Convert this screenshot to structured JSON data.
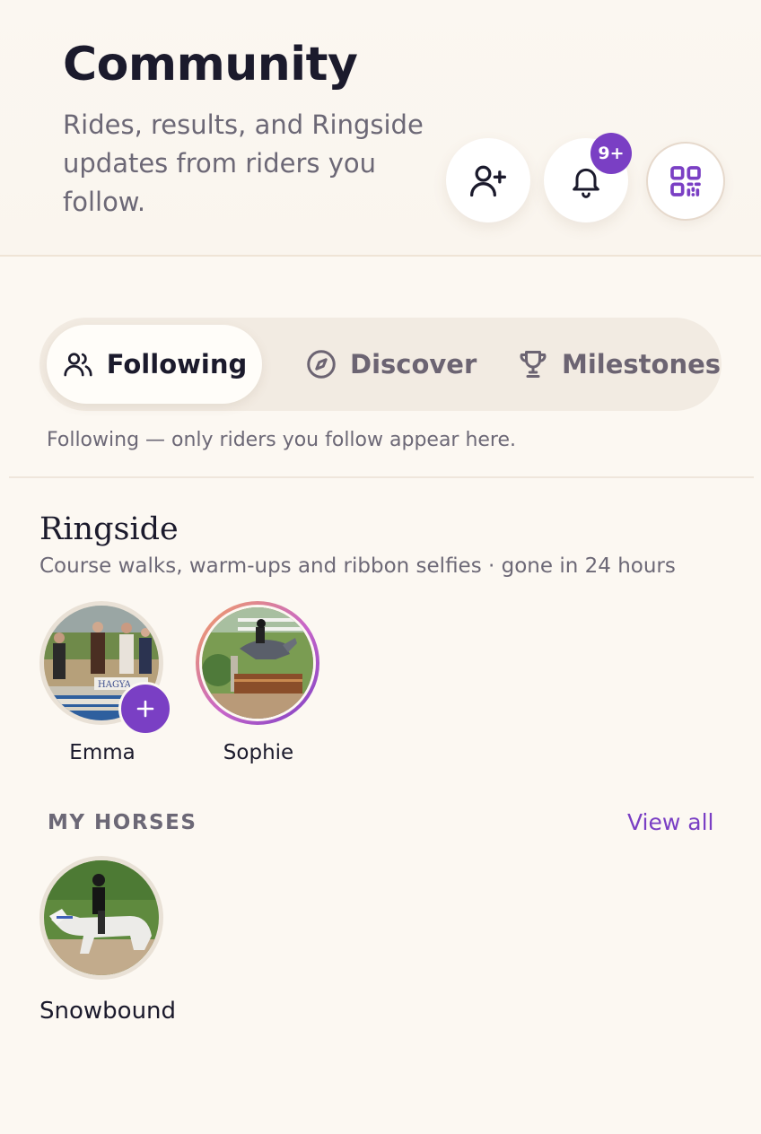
{
  "header": {
    "title": "Community",
    "subtitle": "Rides, results, and Ringside updates from riders you follow.",
    "notification_badge": "9+",
    "buttons": [
      "add-friend-icon",
      "bell-icon",
      "qr-code-icon"
    ]
  },
  "tabs": {
    "items": [
      {
        "label": "Following",
        "icon": "people-icon",
        "active": true
      },
      {
        "label": "Discover",
        "icon": "compass-icon",
        "active": false
      },
      {
        "label": "Milestones",
        "icon": "trophy-icon",
        "active": false
      }
    ],
    "hint": "Following — only riders you follow appear here."
  },
  "ringside": {
    "title": "Ringside",
    "subtitle": "Course walks, warm-ups and ribbon selfies · gone in 24 hours",
    "stories": [
      {
        "name": "Emma",
        "photo": "horse-show-podium-photo",
        "own": true
      },
      {
        "name": "Sophie",
        "photo": "horse-jumping-photo",
        "own": false
      }
    ]
  },
  "my_horses": {
    "label": "MY HORSES",
    "view_all": "View all",
    "horses": [
      {
        "name": "Snowbound",
        "photo": "white-horse-rider-photo"
      }
    ]
  },
  "colors": {
    "accent": "#7a3fc4",
    "background": "#fcf8f2",
    "text": "#1b1a2c",
    "muted": "#6c6876"
  }
}
